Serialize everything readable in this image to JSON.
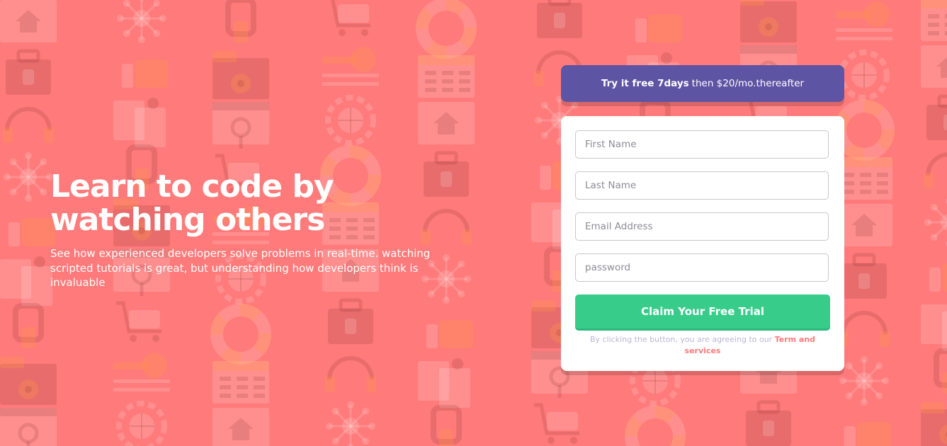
{
  "colors": {
    "background": "#ff7a7a",
    "promo_bg": "#5e54a4",
    "cta_bg": "#38cc8b",
    "link": "#ff7a7a",
    "terms_text": "#bab7d4"
  },
  "hero": {
    "headline_line1": "Learn to code by",
    "headline_line2": "watching others",
    "description": "See how experienced developers solve problems in real-time. watching scripted tutorials is great, but understanding how developers think is invaluable"
  },
  "promo": {
    "bold_text": "Try it free 7days",
    "rest_text": "then $20/mo.thereafter"
  },
  "form": {
    "first_name": {
      "placeholder": "First Name",
      "value": ""
    },
    "last_name": {
      "placeholder": "Last Name",
      "value": ""
    },
    "email": {
      "placeholder": "Email Address",
      "value": ""
    },
    "password": {
      "placeholder": "password",
      "value": ""
    },
    "submit_label": "Claim Your Free Trial",
    "terms_prefix": "By clicking the button, you are agreeing to our",
    "terms_link": "Term and services"
  },
  "background_icons": [
    "house-icon",
    "toolbox-icon",
    "headset-icon",
    "network-icon",
    "thumbs-up-icon",
    "documents-icon",
    "lock-icon",
    "folder-gear-icon",
    "browser-search-icon",
    "cart-icon",
    "key-icon",
    "globe-gear-icon",
    "lifebuoy-icon",
    "calendar-icon"
  ]
}
